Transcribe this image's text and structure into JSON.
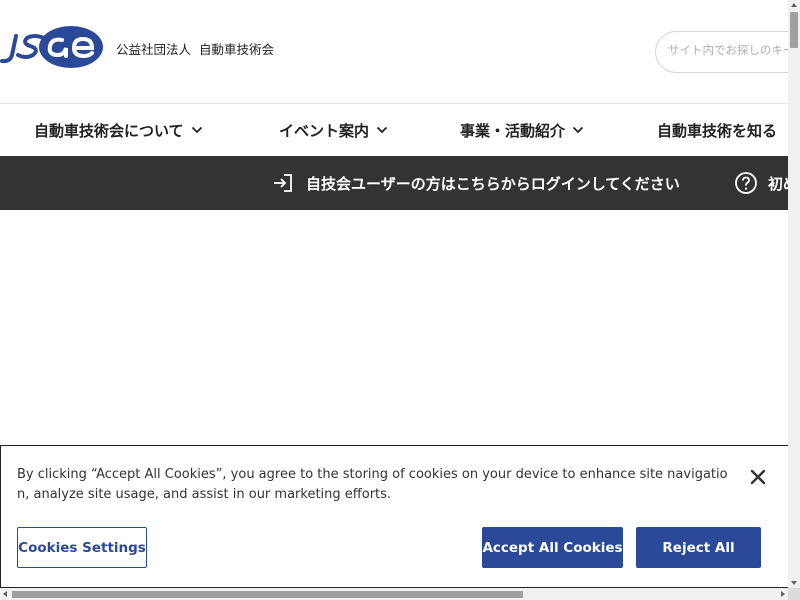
{
  "header": {
    "logo_label": "JSAE",
    "org_type": "公益社団法人",
    "org_name": "自動車技術会",
    "search_placeholder": "サイト内でお探しのキーワード"
  },
  "nav": {
    "items": [
      {
        "label": "自動車技術会について"
      },
      {
        "label": "イベント案内"
      },
      {
        "label": "事業・活動紹介"
      },
      {
        "label": "自動車技術を知る"
      }
    ]
  },
  "login_bar": {
    "login_text": "自技会ユーザーの方はこちらからログインしてください",
    "beginner_text": "初めての方へ"
  },
  "cookie_banner": {
    "text": "By clicking “Accept All Cookies”, you agree to the storing of cookies on your device to enhance site navigation, analyze site usage, and assist in our marketing efforts.",
    "settings_label": "Cookies Settings",
    "accept_label": "Accept All Cookies",
    "reject_label": "Reject All"
  },
  "colors": {
    "brand_blue": "#2a4a99",
    "login_bar_bg": "#333333"
  }
}
